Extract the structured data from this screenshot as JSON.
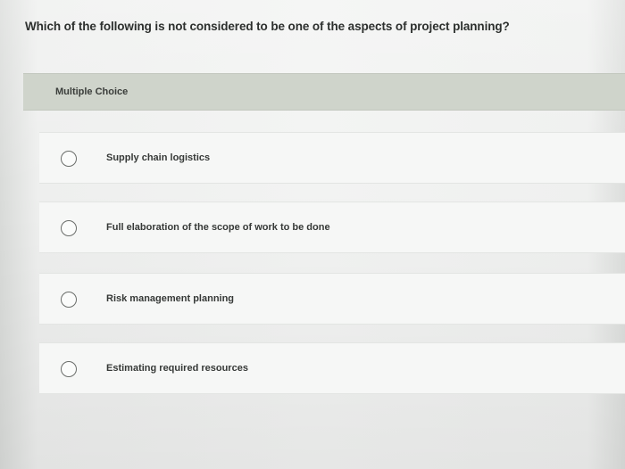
{
  "question": {
    "text": "Which of the following is not considered to be one of the aspects of project planning?"
  },
  "header": {
    "label": "Multiple Choice"
  },
  "options": [
    {
      "label": "Supply chain logistics",
      "selected": false
    },
    {
      "label": "Full elaboration of the scope of work to be done",
      "selected": false
    },
    {
      "label": "Risk management planning",
      "selected": false
    },
    {
      "label": "Estimating required resources",
      "selected": false
    }
  ],
  "colors": {
    "header_band": "#cfd4cb",
    "background": "#f2f3f2",
    "text": "#2d302e"
  },
  "icons": {
    "option_marker": "radio-circle-icon"
  }
}
